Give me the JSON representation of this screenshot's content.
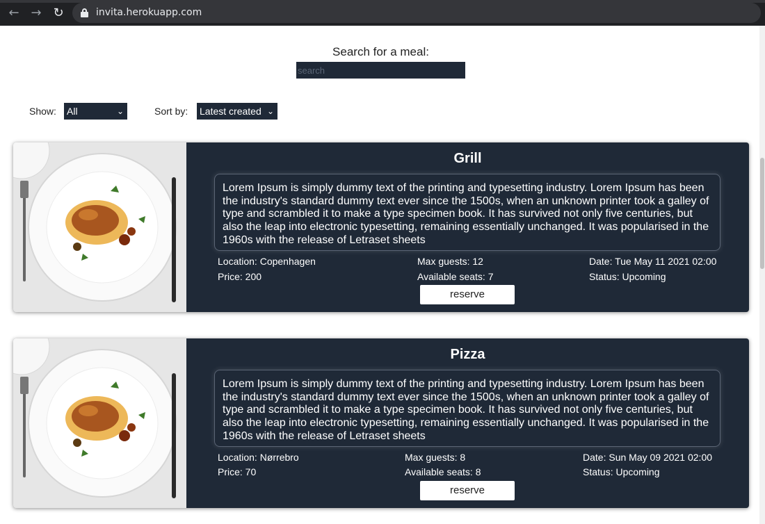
{
  "browser": {
    "url": "invita.herokuapp.com"
  },
  "search": {
    "title": "Search for a meal:",
    "placeholder": "search",
    "value": ""
  },
  "filters": {
    "show_label": "Show:",
    "show_value": "All",
    "sort_label": "Sort by:",
    "sort_value": "Latest created"
  },
  "meals": [
    {
      "title": "Grill",
      "description": "Lorem Ipsum is simply dummy text of the printing and typesetting industry. Lorem Ipsum has been the industry's standard dummy text ever since the 1500s, when an unknown printer took a galley of type and scrambled it to make a type specimen book. It has survived not only five centuries, but also the leap into electronic typesetting, remaining essentially unchanged. It was popularised in the 1960s with the release of Letraset sheets",
      "location": "Location: Copenhagen",
      "price": "Price: 200",
      "max_guests": "Max guests: 12",
      "available_seats": "Available seats: 7",
      "date": "Date: Tue May 11 2021 02:00",
      "status": "Status: Upcoming",
      "reserve_label": "reserve"
    },
    {
      "title": "Pizza",
      "description": "Lorem Ipsum is simply dummy text of the printing and typesetting industry. Lorem Ipsum has been the industry's standard dummy text ever since the 1500s, when an unknown printer took a galley of type and scrambled it to make a type specimen book. It has survived not only five centuries, but also the leap into electronic typesetting, remaining essentially unchanged. It was popularised in the 1960s with the release of Letraset sheets",
      "location": "Location: Nørrebro",
      "price": "Price: 70",
      "max_guests": "Max guests: 8",
      "available_seats": "Available seats: 8",
      "date": "Date: Sun May 09 2021 02:00",
      "status": "Status: Upcoming",
      "reserve_label": "reserve"
    }
  ],
  "colors": {
    "card_background": "#1f2937",
    "input_background": "#1f2937",
    "text_on_dark": "#ffffff"
  }
}
